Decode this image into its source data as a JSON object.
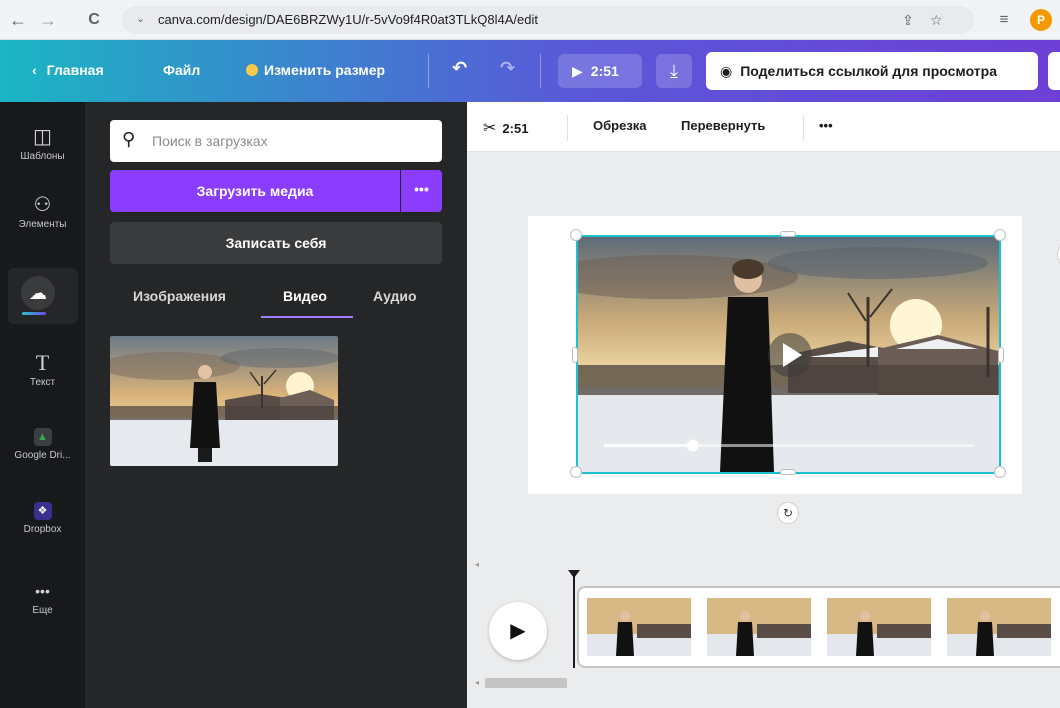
{
  "browser": {
    "back": "←",
    "forward": "→",
    "reload": "C",
    "url": "canva.com/design/DAE6BRZWy1U/r-5vVo9f4R0at3TLkQ8l4A/edit",
    "profile_initial": "P"
  },
  "topbar": {
    "home_label": "Главная",
    "file_label": "Файл",
    "resize_label": "Изменить размер",
    "undo": "↶",
    "redo": "↷",
    "play_duration": "2:51",
    "share_label": "Поделиться ссылкой для просмотра"
  },
  "rail": {
    "items": [
      {
        "label": "Шаблоны",
        "icon": "template-icon"
      },
      {
        "label": "Элементы",
        "icon": "elements-icon"
      },
      {
        "label": "",
        "icon": "upload-cloud-icon"
      },
      {
        "label": "Текст",
        "icon": "text-icon"
      },
      {
        "label": "Google Dri...",
        "icon": "google-drive-icon"
      },
      {
        "label": "Dropbox",
        "icon": "dropbox-icon"
      },
      {
        "label": "Еще",
        "icon": "more-icon"
      }
    ]
  },
  "panel": {
    "search_placeholder": "Поиск в загрузках",
    "upload_label": "Загрузить медиа",
    "upload_more": "•••",
    "record_label": "Записать себя",
    "tabs": [
      {
        "label": "Изображения"
      },
      {
        "label": "Видео"
      },
      {
        "label": "Аудио"
      }
    ],
    "active_tab": "Видео"
  },
  "editor": {
    "toolbar": {
      "duration": "2:51",
      "trim_label": "Обрезка",
      "flip_label": "Перевернуть",
      "more": "•••"
    },
    "video_progress": 0.24
  },
  "colors": {
    "accent_purple": "#8b3dff",
    "selection_teal": "#1fc1cf",
    "dark_panel": "#252627",
    "rail_bg": "#18191b"
  }
}
